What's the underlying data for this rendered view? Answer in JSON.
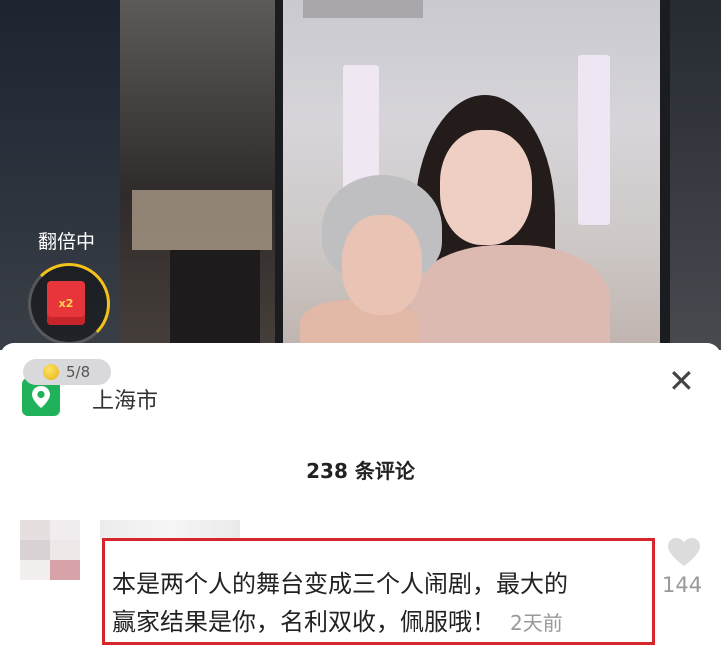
{
  "overlay": {
    "boost_label": "翻倍中",
    "envelope_badge": "x2",
    "coin_progress": "5/8"
  },
  "location": {
    "icon": "location-pin-icon",
    "city": "上海市"
  },
  "comments_header": {
    "count_text": "238 条评论"
  },
  "comment": {
    "line1": "本是两个人的舞台变成三个人闹剧，最大的",
    "line2": "赢家结果是你，名利双收，佩服哦！",
    "time": "2天前",
    "likes": "144"
  },
  "colors": {
    "location_green": "#1fb25a",
    "highlight_red": "#d6262b",
    "coin_ring": "#f3c21b"
  }
}
